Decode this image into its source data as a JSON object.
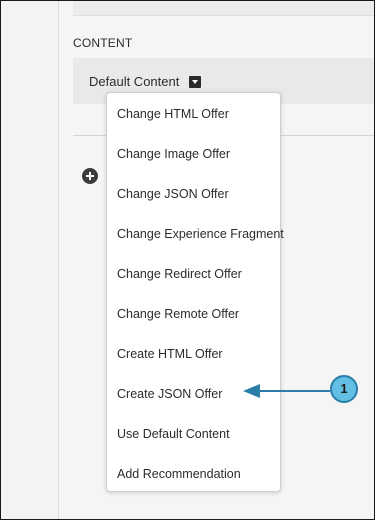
{
  "section": {
    "label": "CONTENT",
    "content_value": "Default Content"
  },
  "menu": {
    "items": [
      "Change HTML Offer",
      "Change Image Offer",
      "Change JSON Offer",
      "Change Experience Fragment",
      "Change Redirect Offer",
      "Change Remote Offer",
      "Create HTML Offer",
      "Create JSON Offer",
      "Use Default Content",
      "Add Recommendation"
    ]
  },
  "callout": {
    "number": "1",
    "color": "#63bfe3",
    "arrow_color": "#2a7ea8"
  },
  "icons": [
    "add-icon",
    "chevron-down-icon"
  ]
}
